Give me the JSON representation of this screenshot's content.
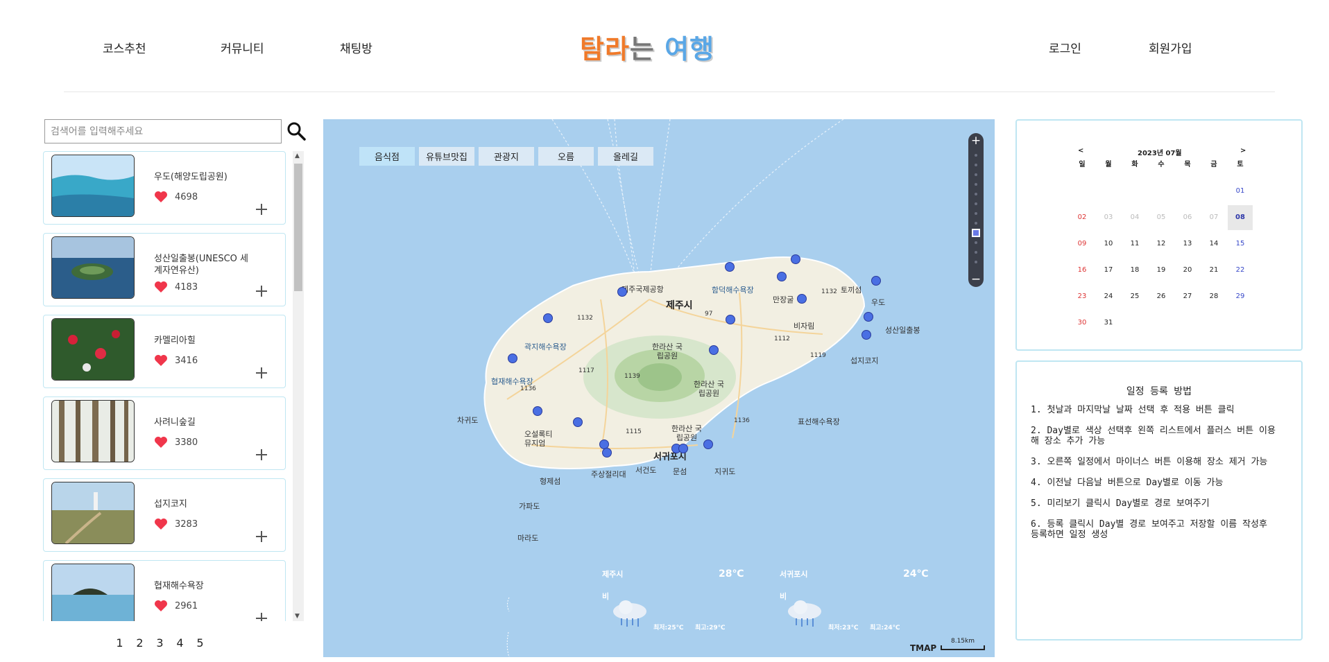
{
  "nav": {
    "links": [
      "코스추천",
      "커뮤니티",
      "채팅방"
    ],
    "logo": [
      "탐라",
      "는 ",
      "여행"
    ],
    "auth": [
      "로그인",
      "회원가입"
    ]
  },
  "search": {
    "placeholder": "검색어를 입력해주세요",
    "value": "",
    "icon": "search-icon"
  },
  "places": [
    {
      "name": "우도(해양도립공원)",
      "likes": "4698"
    },
    {
      "name": "성산일출봉(UNESCO 세계자연유산)",
      "likes": "4183"
    },
    {
      "name": "카멜리아힐",
      "likes": "3416"
    },
    {
      "name": "사려니숲길",
      "likes": "3380"
    },
    {
      "name": "섭지코지",
      "likes": "3283"
    },
    {
      "name": "협재해수욕장",
      "likes": "2961"
    }
  ],
  "pagination": [
    "1",
    "2",
    "3",
    "4",
    "5"
  ],
  "map": {
    "categories": [
      "음식점",
      "유튜브맛집",
      "관광지",
      "오름",
      "올레길"
    ],
    "labels": {
      "jeju_city": "제주시",
      "seogwipo": "서귀포시",
      "airport": "제주국제공항",
      "hamdeok": "함덕해수욕장",
      "manjanggul": "만장굴",
      "bijarim": "비자림",
      "toekkiseom": "토끼섬",
      "udo": "우도",
      "seongsan": "성산일출봉",
      "seopjikoji": "섭지코지",
      "pyoseon": "표선해수욕장",
      "gwakji": "곽지해수욕장",
      "hyeopjae": "협재해수욕장",
      "chagwido": "차귀도",
      "osulloc": "오설록티 뮤지엄",
      "hallasan1": "한라산 국립공원",
      "hallasan2": "한라산 국립공원",
      "hallasan3": "한라산 국립공원",
      "jusangjeolli": "주상절리대",
      "seogwido": "서건도",
      "munseom": "문섬",
      "jigwido": "지귀도",
      "hyeongjeseom": "형제섬",
      "gapado": "가파도",
      "marado": "마라도",
      "r1132a": "1132",
      "r1132b": "1132",
      "r97": "97",
      "r1112": "1112",
      "r1119": "1119",
      "r1117": "1117",
      "r1139": "1139",
      "r1136a": "1136",
      "r1136b": "1136",
      "r1115": "1115"
    },
    "weather": [
      {
        "city": "제주시",
        "condition": "비",
        "temp": "28℃",
        "low": "최저:25℃",
        "high": "최고:29℃"
      },
      {
        "city": "서귀포시",
        "condition": "비",
        "temp": "24℃",
        "low": "최저:23℃",
        "high": "최고:24℃"
      }
    ],
    "brand": "TMAP",
    "scale": "8.15km"
  },
  "calendar": {
    "prev": "<",
    "next": ">",
    "title": "2023년 07월",
    "weekdays": [
      "일",
      "월",
      "화",
      "수",
      "목",
      "금",
      "토"
    ],
    "selected": "08",
    "weeks": [
      [
        "",
        "",
        "",
        "",
        "",
        "",
        "01"
      ],
      [
        "02",
        "03",
        "04",
        "05",
        "06",
        "07",
        "08"
      ],
      [
        "09",
        "10",
        "11",
        "12",
        "13",
        "14",
        "15"
      ],
      [
        "16",
        "17",
        "18",
        "19",
        "20",
        "21",
        "22"
      ],
      [
        "23",
        "24",
        "25",
        "26",
        "27",
        "28",
        "29"
      ],
      [
        "30",
        "31",
        "",
        "",
        "",
        "",
        ""
      ]
    ]
  },
  "guide": {
    "title": "일정 등록 방법",
    "steps": [
      "1. 첫날과 마지막날 날짜 선택 후 적용 버튼 클릭",
      "2. Day별로 색상 선택후 왼쪽 리스트에서 플러스 버튼 이용해 장소 추가 가능",
      "3. 오른쪽 일정에서 마이너스 버튼 이용해 장소 제거 가능",
      "4. 이전날 다음날 버튼으로 Day별로 이동 가능",
      "5. 미리보기 클릭시 Day별로 경로 보여주기",
      "6. 등록 클릭시 Day별 경로 보여주고 저장할 이름 작성후 등록하면 일정 생성"
    ]
  }
}
